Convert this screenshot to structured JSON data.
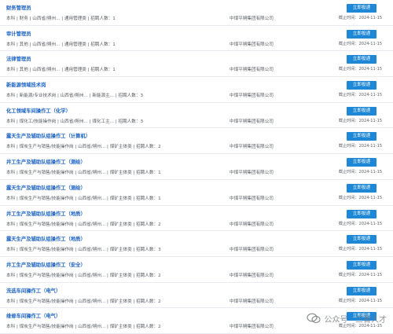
{
  "apply_label": "立即投递",
  "deadline_prefix": "截止时间：",
  "watermark_text": "公众号 · 三晋人才",
  "jobs": [
    {
      "title": "财务管理员",
      "meta": "本科 | 财务 | 山西省/朔州... | 通用管理类 | 招聘人数：1",
      "company": "中煤平朔集团有限公司",
      "deadline": "2024-11-15"
    },
    {
      "title": "审计管理员",
      "meta": "本科 | 其他 | 山西省/朔州... | 通用管理类 | 招聘人数：1",
      "company": "中煤平朔集团有限公司",
      "deadline": "2024-11-15"
    },
    {
      "title": "法律管理员",
      "meta": "本科 | 其他 | 山西省/朔州... | 通用管理类 | 招聘人数：1",
      "company": "中煤平朔集团有限公司",
      "deadline": "2024-11-15"
    },
    {
      "title": "新能源领域技术岗",
      "meta": "本科 | 新能源/专业技术岗 | 山西省/朔州... | 新能源主... | 招聘人数：3",
      "company": "中煤平朔集团有限公司",
      "deadline": "2024-11-15"
    },
    {
      "title": "化工领域车间操作工（化学）",
      "meta": "本科 | 煤化工/技能操作岗 | 山西省/朔州... | 煤化工主... | 招聘人数：3",
      "company": "中煤平朔集团有限公司",
      "deadline": "2024-11-15"
    },
    {
      "title": "露天生产及辅助队组操作工（计算机）",
      "meta": "本科 | 煤炭生产与销售/技能操作岗 | 山西省/朔州... | 煤矿主体类 | 招聘人数：2",
      "company": "中煤平朔集团有限公司",
      "deadline": "2024-11-15"
    },
    {
      "title": "井工生产及辅助队组操作工（测绘）",
      "meta": "本科 | 煤炭生产与销售/技能操作岗 | 山西省/朔州... | 煤矿主体类 | 招聘人数：1",
      "company": "中煤平朔集团有限公司",
      "deadline": "2024-11-15"
    },
    {
      "title": "露天生产及辅助队组操作工（测绘）",
      "meta": "本科 | 煤炭生产与销售/技能操作岗 | 山西省/朔州... | 煤矿主体类 | 招聘人数：1",
      "company": "中煤平朔集团有限公司",
      "deadline": "2024-11-15"
    },
    {
      "title": "井工生产及辅助队组操作工（地质）",
      "meta": "本科 | 煤炭生产与销售/技能操作岗 | 山西省/朔州... | 煤矿主体类 | 招聘人数：2",
      "company": "中煤平朔集团有限公司",
      "deadline": "2024-11-15"
    },
    {
      "title": "露天生产及辅助队组操作工（地质）",
      "meta": "本科 | 煤炭生产与销售/技能操作岗 | 山西省/朔州... | 煤矿主体类 | 招聘人数：3",
      "company": "中煤平朔集团有限公司",
      "deadline": "2024-11-15"
    },
    {
      "title": "井工生产及辅助队组操作工（安全）",
      "meta": "本科 | 煤炭生产与销售/技能操作岗 | 山西省/朔州... | 煤矿主体类 | 招聘人数：2",
      "company": "中煤平朔集团有限公司",
      "deadline": "2024-11-15"
    },
    {
      "title": "洗选车间操作工（电气）",
      "meta": "本科 | 煤炭生产与销售/技能操作岗 | 山西省/朔州... | 煤矿主体类 | 招聘人数：2",
      "company": "中煤平朔集团有限公司",
      "deadline": "2024-11-15"
    },
    {
      "title": "维修车间操作工（电气）",
      "meta": "本科 | 煤炭生产与销售/技能操作岗 | 山西省/朔州... | 煤矿主体类 | 招聘人数：2",
      "company": "中煤平朔集团有限公司",
      "deadline": "2024-11-15"
    }
  ]
}
